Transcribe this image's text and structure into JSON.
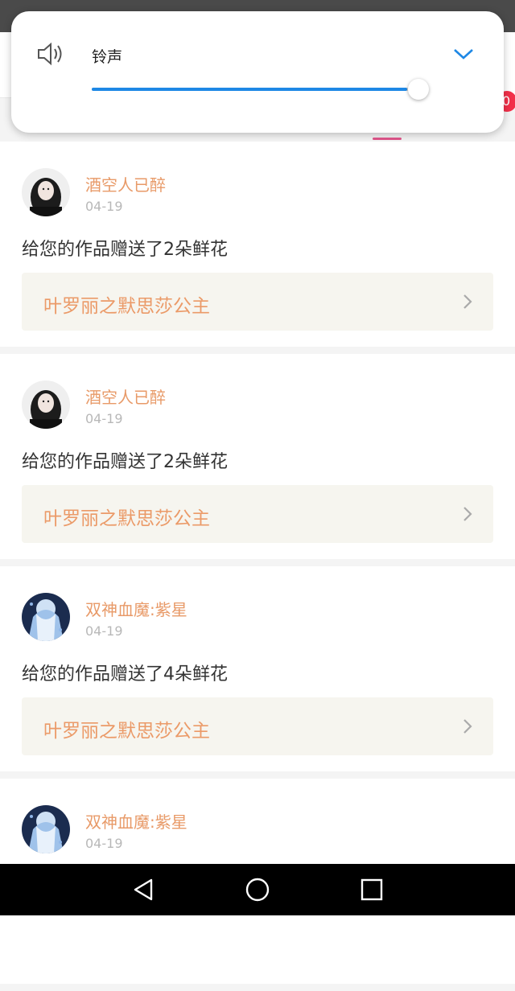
{
  "volume_popup": {
    "label": "铃声",
    "level_percent": 97,
    "accent": "#1e88e5"
  },
  "notification_badge": "0",
  "notifications": [
    {
      "username": "酒空人已醉",
      "date": "04-19",
      "message": "给您的作品赠送了2朵鲜花",
      "work_title": "叶罗丽之默思莎公主",
      "avatar": "girl-avatar"
    },
    {
      "username": "酒空人已醉",
      "date": "04-19",
      "message": "给您的作品赠送了2朵鲜花",
      "work_title": "叶罗丽之默思莎公主",
      "avatar": "girl-avatar"
    },
    {
      "username": "双神血魔:紫星",
      "date": "04-19",
      "message": "给您的作品赠送了4朵鲜花",
      "work_title": "叶罗丽之默思莎公主",
      "avatar": "anime-avatar"
    },
    {
      "username": "双神血魔:紫星",
      "date": "04-19",
      "message": "",
      "work_title": "",
      "avatar": "anime-avatar"
    }
  ],
  "colors": {
    "username": "#e89a68",
    "work_title": "#eb9a68",
    "link_bg": "#f6f5ef",
    "tab_indicator": "#e0558a"
  },
  "nav": {
    "back": "back-icon",
    "home": "home-icon",
    "recents": "recents-icon"
  }
}
